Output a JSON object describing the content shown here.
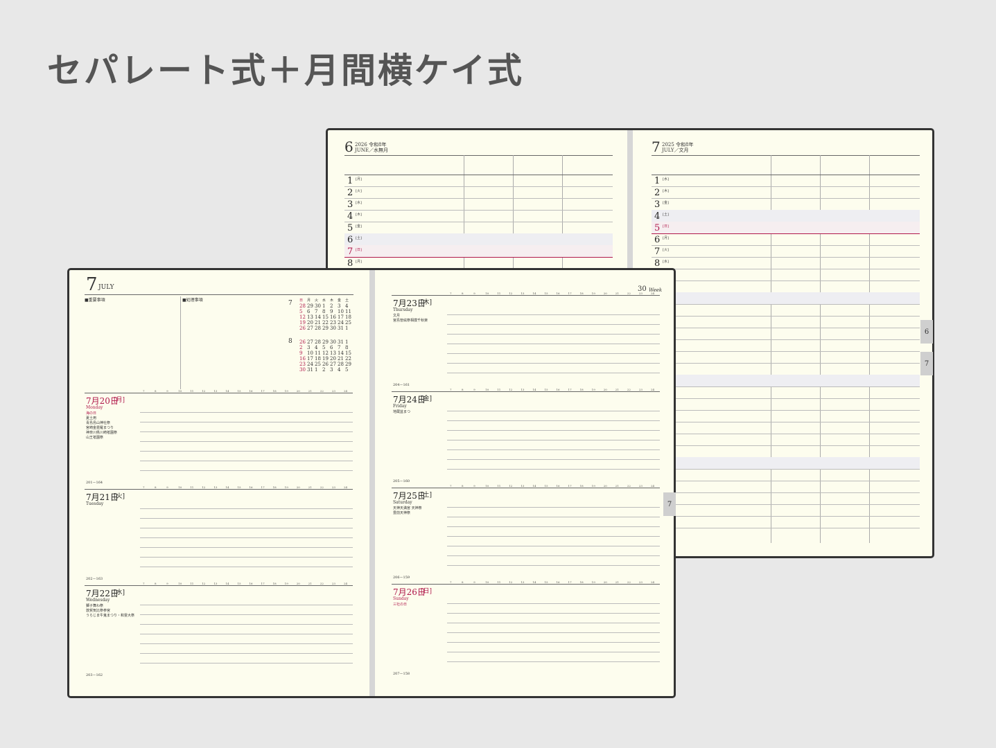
{
  "page_title": "セパレート式＋月間横ケイ式",
  "back_book": {
    "left_page": {
      "month_num": "6",
      "month_sub": "2026 令和8年",
      "month_name": "JUNE／水無月",
      "days": [
        {
          "num": "1",
          "wd": "[月]"
        },
        {
          "num": "2",
          "wd": "[火]"
        },
        {
          "num": "3",
          "wd": "[水]"
        },
        {
          "num": "4",
          "wd": "[木]"
        },
        {
          "num": "5",
          "wd": "[金]"
        },
        {
          "num": "6",
          "wd": "[土]"
        },
        {
          "num": "7",
          "wd": "[日]"
        },
        {
          "num": "8",
          "wd": "[月]"
        }
      ]
    },
    "right_page": {
      "month_num": "7",
      "month_sub": "2025 令和8年",
      "month_name": "JULY／文月",
      "days": [
        {
          "num": "1",
          "wd": "[水]"
        },
        {
          "num": "2",
          "wd": "[木]"
        },
        {
          "num": "3",
          "wd": "[金]"
        },
        {
          "num": "4",
          "wd": "[土]"
        },
        {
          "num": "5",
          "wd": "[日]"
        },
        {
          "num": "6",
          "wd": "[月]"
        },
        {
          "num": "7",
          "wd": "[火]"
        },
        {
          "num": "8",
          "wd": "[水]"
        }
      ]
    },
    "tabs": [
      "6",
      "7"
    ]
  },
  "front_book": {
    "month_num": "7",
    "month_name": "JULY",
    "week_label": "30",
    "week_suffix": "Week",
    "memo_label_1": "重要事項",
    "memo_label_2": "処理事項",
    "tab": "7",
    "mini_cal": {
      "m1": "7",
      "m2": "8",
      "weekday_row": [
        "日",
        "月",
        "火",
        "水",
        "木",
        "金",
        "土"
      ],
      "rows_m1": [
        [
          "28",
          "29",
          "30",
          "1",
          "2",
          "3",
          "4"
        ],
        [
          "5",
          "6",
          "7",
          "8",
          "9",
          "10",
          "11"
        ],
        [
          "12",
          "13",
          "14",
          "15",
          "16",
          "17",
          "18"
        ],
        [
          "19",
          "20",
          "21",
          "22",
          "23",
          "24",
          "25"
        ],
        [
          "26",
          "27",
          "28",
          "29",
          "30",
          "31",
          "1"
        ]
      ],
      "rows_m2": [
        [
          "26",
          "27",
          "28",
          "29",
          "30",
          "31",
          "1"
        ],
        [
          "2",
          "3",
          "4",
          "5",
          "6",
          "7",
          "8"
        ],
        [
          "9",
          "10",
          "11",
          "12",
          "13",
          "14",
          "15"
        ],
        [
          "16",
          "17",
          "18",
          "19",
          "20",
          "21",
          "22"
        ],
        [
          "23",
          "24",
          "25",
          "26",
          "27",
          "28",
          "29"
        ],
        [
          "30",
          "31",
          "1",
          "2",
          "3",
          "4",
          "5"
        ]
      ]
    },
    "hours": [
      "7",
      "8",
      "9",
      "10",
      "11",
      "12",
      "13",
      "14",
      "15",
      "16",
      "17",
      "18",
      "19",
      "20",
      "21",
      "22",
      "23",
      "24"
    ],
    "left_days": [
      {
        "date": "7月20日",
        "wd": "[月]",
        "sub": "Monday",
        "notes": [
          "海の日",
          "夏土用",
          "青島島山神社祭",
          "宮崎金毘羅まつり",
          "神奈川県川崎祇園祭",
          "山王祇園祭"
        ],
        "foot": "201－164",
        "red": true
      },
      {
        "date": "7月21日",
        "wd": "[火]",
        "sub": "Tuesday",
        "notes": [],
        "foot": "202－163",
        "red": false
      },
      {
        "date": "7月22日",
        "wd": "[水]",
        "sub": "Wednesday",
        "notes": [
          "獅子舞わ祭",
          "敦賀気比祭参宮",
          "うらじま牛鬼まつり・和霊大祭"
        ],
        "foot": "203－162",
        "red": false
      }
    ],
    "right_days": [
      {
        "date": "7月23日",
        "wd": "[木]",
        "sub": "Thursday",
        "notes": [
          "文月",
          "宮島管絃祭相撲千秋楽"
        ],
        "foot": "204－161",
        "red": false
      },
      {
        "date": "7月24日",
        "wd": "[金]",
        "sub": "Friday",
        "notes": [
          "地蔵盆まつ"
        ],
        "foot": "205－160",
        "red": false
      },
      {
        "date": "7月25日",
        "wd": "[土]",
        "sub": "Saturday",
        "notes": [
          "天神天満宮 天神祭",
          "豊前天神祭"
        ],
        "foot": "206－159",
        "red": false
      },
      {
        "date": "7月26日",
        "wd": "[日]",
        "sub": "Sunday",
        "notes": [
          "三社の日"
        ],
        "foot": "207－158",
        "red": true
      }
    ]
  }
}
